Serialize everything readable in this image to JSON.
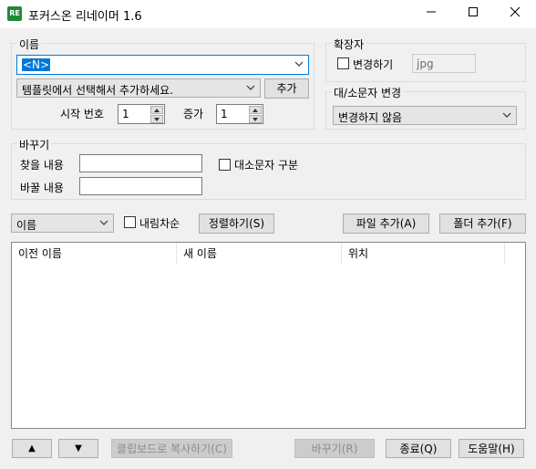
{
  "window": {
    "icon_text": "RE",
    "title": "포커스온 리네이머 1.6",
    "minimize": "—",
    "maximize": "☐",
    "close": "✕"
  },
  "name_group": {
    "label": "이름",
    "pattern_value": "<N>",
    "template_placeholder": "템플릿에서 선택해서 추가하세요.",
    "add_button": "추가",
    "start_number_label": "시작 번호",
    "start_number_value": "1",
    "increment_label": "증가",
    "increment_value": "1"
  },
  "extension_group": {
    "label": "확장자",
    "change_checkbox_label": "변경하기",
    "change_checked": false,
    "extension_value": "jpg"
  },
  "case_group": {
    "label": "대/소문자 변경",
    "selected": "변경하지 않음"
  },
  "replace_group": {
    "label": "바꾸기",
    "find_label": "찾을 내용",
    "find_value": "",
    "replace_label": "바꿀 내용",
    "replace_value": "",
    "case_sensitive_label": "대소문자 구분",
    "case_sensitive_checked": false
  },
  "sort_bar": {
    "sort_by": "이름",
    "descending_label": "내림차순",
    "descending_checked": false,
    "sort_button": "정렬하기(S)",
    "add_file_button": "파일 추가(A)",
    "add_folder_button": "폴더 추가(F)"
  },
  "file_list": {
    "columns": [
      "이전 이름",
      "새 이름",
      "위치"
    ],
    "rows": []
  },
  "bottom_bar": {
    "move_up": "▲",
    "move_down": "▼",
    "copy_clipboard": "클립보드로 복사하기(C)",
    "rename": "바꾸기(R)",
    "exit": "종료(Q)",
    "help": "도움말(H)"
  }
}
